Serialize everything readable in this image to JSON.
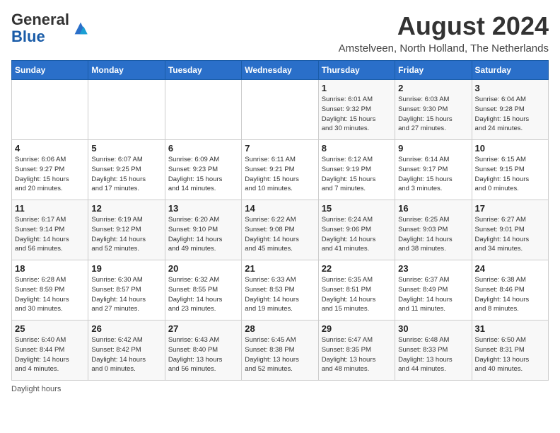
{
  "header": {
    "logo_general": "General",
    "logo_blue": "Blue",
    "month_year": "August 2024",
    "location": "Amstelveen, North Holland, The Netherlands"
  },
  "days_of_week": [
    "Sunday",
    "Monday",
    "Tuesday",
    "Wednesday",
    "Thursday",
    "Friday",
    "Saturday"
  ],
  "footnote": "Daylight hours",
  "weeks": [
    [
      {
        "day": "",
        "info": ""
      },
      {
        "day": "",
        "info": ""
      },
      {
        "day": "",
        "info": ""
      },
      {
        "day": "",
        "info": ""
      },
      {
        "day": "1",
        "info": "Sunrise: 6:01 AM\nSunset: 9:32 PM\nDaylight: 15 hours\nand 30 minutes."
      },
      {
        "day": "2",
        "info": "Sunrise: 6:03 AM\nSunset: 9:30 PM\nDaylight: 15 hours\nand 27 minutes."
      },
      {
        "day": "3",
        "info": "Sunrise: 6:04 AM\nSunset: 9:28 PM\nDaylight: 15 hours\nand 24 minutes."
      }
    ],
    [
      {
        "day": "4",
        "info": "Sunrise: 6:06 AM\nSunset: 9:27 PM\nDaylight: 15 hours\nand 20 minutes."
      },
      {
        "day": "5",
        "info": "Sunrise: 6:07 AM\nSunset: 9:25 PM\nDaylight: 15 hours\nand 17 minutes."
      },
      {
        "day": "6",
        "info": "Sunrise: 6:09 AM\nSunset: 9:23 PM\nDaylight: 15 hours\nand 14 minutes."
      },
      {
        "day": "7",
        "info": "Sunrise: 6:11 AM\nSunset: 9:21 PM\nDaylight: 15 hours\nand 10 minutes."
      },
      {
        "day": "8",
        "info": "Sunrise: 6:12 AM\nSunset: 9:19 PM\nDaylight: 15 hours\nand 7 minutes."
      },
      {
        "day": "9",
        "info": "Sunrise: 6:14 AM\nSunset: 9:17 PM\nDaylight: 15 hours\nand 3 minutes."
      },
      {
        "day": "10",
        "info": "Sunrise: 6:15 AM\nSunset: 9:15 PM\nDaylight: 15 hours\nand 0 minutes."
      }
    ],
    [
      {
        "day": "11",
        "info": "Sunrise: 6:17 AM\nSunset: 9:14 PM\nDaylight: 14 hours\nand 56 minutes."
      },
      {
        "day": "12",
        "info": "Sunrise: 6:19 AM\nSunset: 9:12 PM\nDaylight: 14 hours\nand 52 minutes."
      },
      {
        "day": "13",
        "info": "Sunrise: 6:20 AM\nSunset: 9:10 PM\nDaylight: 14 hours\nand 49 minutes."
      },
      {
        "day": "14",
        "info": "Sunrise: 6:22 AM\nSunset: 9:08 PM\nDaylight: 14 hours\nand 45 minutes."
      },
      {
        "day": "15",
        "info": "Sunrise: 6:24 AM\nSunset: 9:06 PM\nDaylight: 14 hours\nand 41 minutes."
      },
      {
        "day": "16",
        "info": "Sunrise: 6:25 AM\nSunset: 9:03 PM\nDaylight: 14 hours\nand 38 minutes."
      },
      {
        "day": "17",
        "info": "Sunrise: 6:27 AM\nSunset: 9:01 PM\nDaylight: 14 hours\nand 34 minutes."
      }
    ],
    [
      {
        "day": "18",
        "info": "Sunrise: 6:28 AM\nSunset: 8:59 PM\nDaylight: 14 hours\nand 30 minutes."
      },
      {
        "day": "19",
        "info": "Sunrise: 6:30 AM\nSunset: 8:57 PM\nDaylight: 14 hours\nand 27 minutes."
      },
      {
        "day": "20",
        "info": "Sunrise: 6:32 AM\nSunset: 8:55 PM\nDaylight: 14 hours\nand 23 minutes."
      },
      {
        "day": "21",
        "info": "Sunrise: 6:33 AM\nSunset: 8:53 PM\nDaylight: 14 hours\nand 19 minutes."
      },
      {
        "day": "22",
        "info": "Sunrise: 6:35 AM\nSunset: 8:51 PM\nDaylight: 14 hours\nand 15 minutes."
      },
      {
        "day": "23",
        "info": "Sunrise: 6:37 AM\nSunset: 8:49 PM\nDaylight: 14 hours\nand 11 minutes."
      },
      {
        "day": "24",
        "info": "Sunrise: 6:38 AM\nSunset: 8:46 PM\nDaylight: 14 hours\nand 8 minutes."
      }
    ],
    [
      {
        "day": "25",
        "info": "Sunrise: 6:40 AM\nSunset: 8:44 PM\nDaylight: 14 hours\nand 4 minutes."
      },
      {
        "day": "26",
        "info": "Sunrise: 6:42 AM\nSunset: 8:42 PM\nDaylight: 14 hours\nand 0 minutes."
      },
      {
        "day": "27",
        "info": "Sunrise: 6:43 AM\nSunset: 8:40 PM\nDaylight: 13 hours\nand 56 minutes."
      },
      {
        "day": "28",
        "info": "Sunrise: 6:45 AM\nSunset: 8:38 PM\nDaylight: 13 hours\nand 52 minutes."
      },
      {
        "day": "29",
        "info": "Sunrise: 6:47 AM\nSunset: 8:35 PM\nDaylight: 13 hours\nand 48 minutes."
      },
      {
        "day": "30",
        "info": "Sunrise: 6:48 AM\nSunset: 8:33 PM\nDaylight: 13 hours\nand 44 minutes."
      },
      {
        "day": "31",
        "info": "Sunrise: 6:50 AM\nSunset: 8:31 PM\nDaylight: 13 hours\nand 40 minutes."
      }
    ]
  ]
}
